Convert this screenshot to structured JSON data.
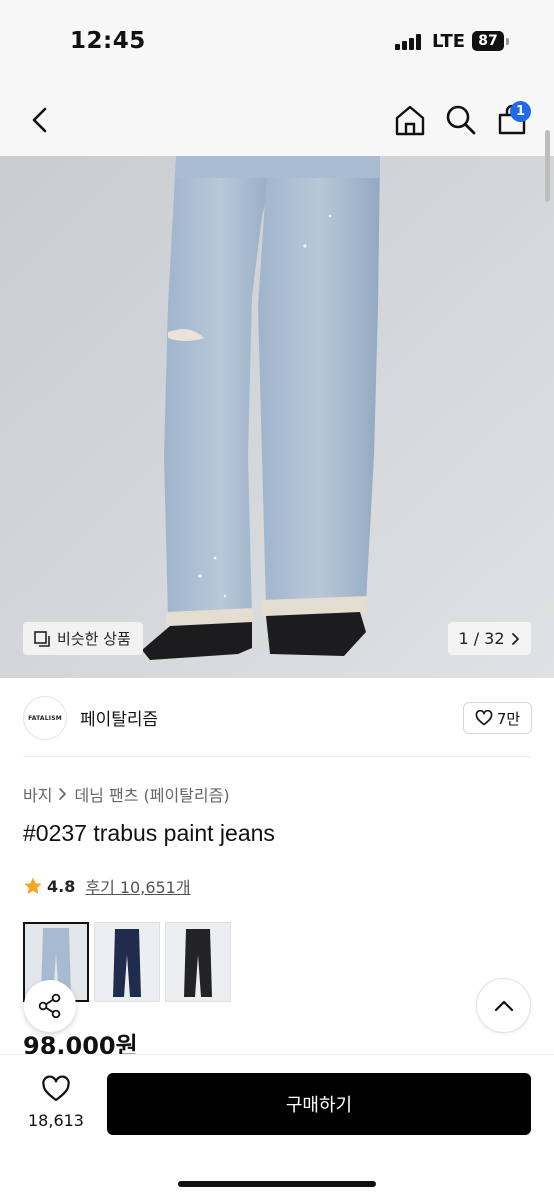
{
  "status_bar": {
    "time": "12:45",
    "network": "LTE",
    "battery": "87"
  },
  "header": {
    "cart_count": "1"
  },
  "gallery": {
    "similar_label": "비슷한 상품",
    "counter": "1 / 32"
  },
  "brand": {
    "logo_text": "FATALISM",
    "name": "페이탈리즘",
    "likes": "7만"
  },
  "breadcrumb": {
    "category": "바지",
    "subcategory": "데님 팬츠 (페이탈리즘)"
  },
  "product": {
    "title": "#0237 trabus paint jeans",
    "rating": "4.8",
    "reviews": "후기 10,651개",
    "price": "98,000원"
  },
  "thumbnails": [
    {
      "color": "light-blue",
      "selected": true
    },
    {
      "color": "dark-indigo",
      "selected": false
    },
    {
      "color": "black",
      "selected": false
    }
  ],
  "bottom_bar": {
    "wish_count": "18,613",
    "buy_label": "구매하기"
  },
  "colors": {
    "accent": "#1f6ae8",
    "star": "#f5a623",
    "buy_button": "#000000"
  }
}
